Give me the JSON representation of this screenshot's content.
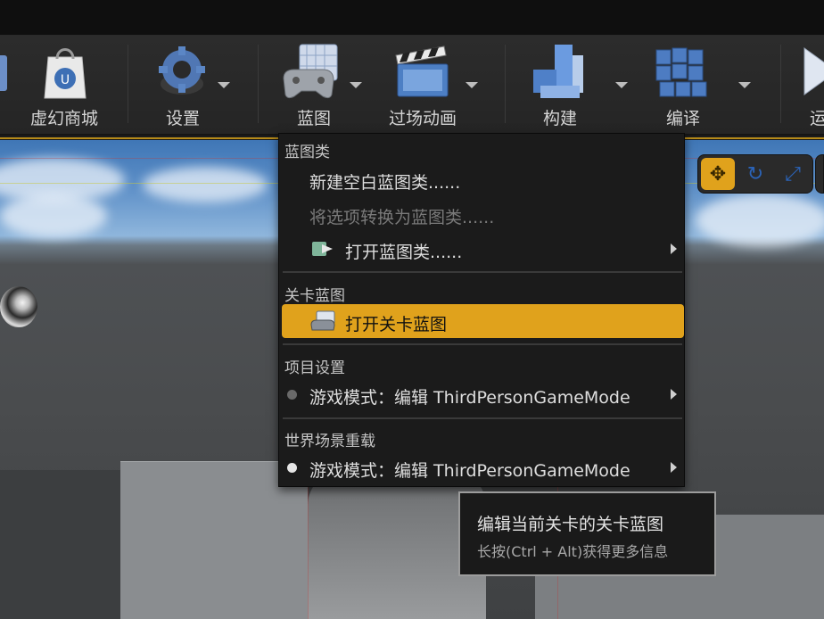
{
  "toolbar": {
    "buttons": [
      {
        "label": "虚幻商城",
        "icon": "marketplace-bag-icon"
      },
      {
        "label": "设置",
        "icon": "settings-gear-icon"
      },
      {
        "label": "蓝图",
        "icon": "blueprint-gamepad-icon"
      },
      {
        "label": "过场动画",
        "icon": "cinematics-clapper-icon"
      },
      {
        "label": "构建",
        "icon": "build-blocks-icon"
      },
      {
        "label": "编译",
        "icon": "compile-cubes-icon"
      },
      {
        "label": "运",
        "icon": "play-triangle-icon"
      }
    ]
  },
  "viewport_tools": [
    "translate-icon",
    "rotate-icon",
    "scale-icon"
  ],
  "menu": {
    "sections": [
      {
        "header": "蓝图类",
        "items": [
          {
            "label": "新建空白蓝图类......",
            "enabled": true
          },
          {
            "label": "将选项转换为蓝图类......",
            "enabled": false
          },
          {
            "label": "打开蓝图类......",
            "enabled": true,
            "icon": "open-blueprint-icon",
            "submenu": true
          }
        ]
      },
      {
        "header": "关卡蓝图",
        "items": [
          {
            "label": "打开关卡蓝图",
            "enabled": true,
            "icon": "level-blueprint-icon",
            "highlighted": true
          }
        ]
      },
      {
        "header": "项目设置",
        "items": [
          {
            "label": "游戏模式：编辑 ThirdPersonGameMode",
            "enabled": true,
            "dot_color": "#6a6a6a",
            "submenu": true
          }
        ]
      },
      {
        "header": "世界场景重载",
        "items": [
          {
            "label": "游戏模式：编辑 ThirdPersonGameMode",
            "enabled": true,
            "dot_color": "#e6e6e6",
            "submenu": true
          }
        ]
      }
    ]
  },
  "tooltip": {
    "title": "编辑当前关卡的关卡蓝图",
    "subtitle": "长按(Ctrl + Alt)获得更多信息"
  },
  "colors": {
    "accent": "#e0a21c",
    "menu_bg": "#1b1b1b",
    "toolbar_bg": "#2c2c2c"
  }
}
